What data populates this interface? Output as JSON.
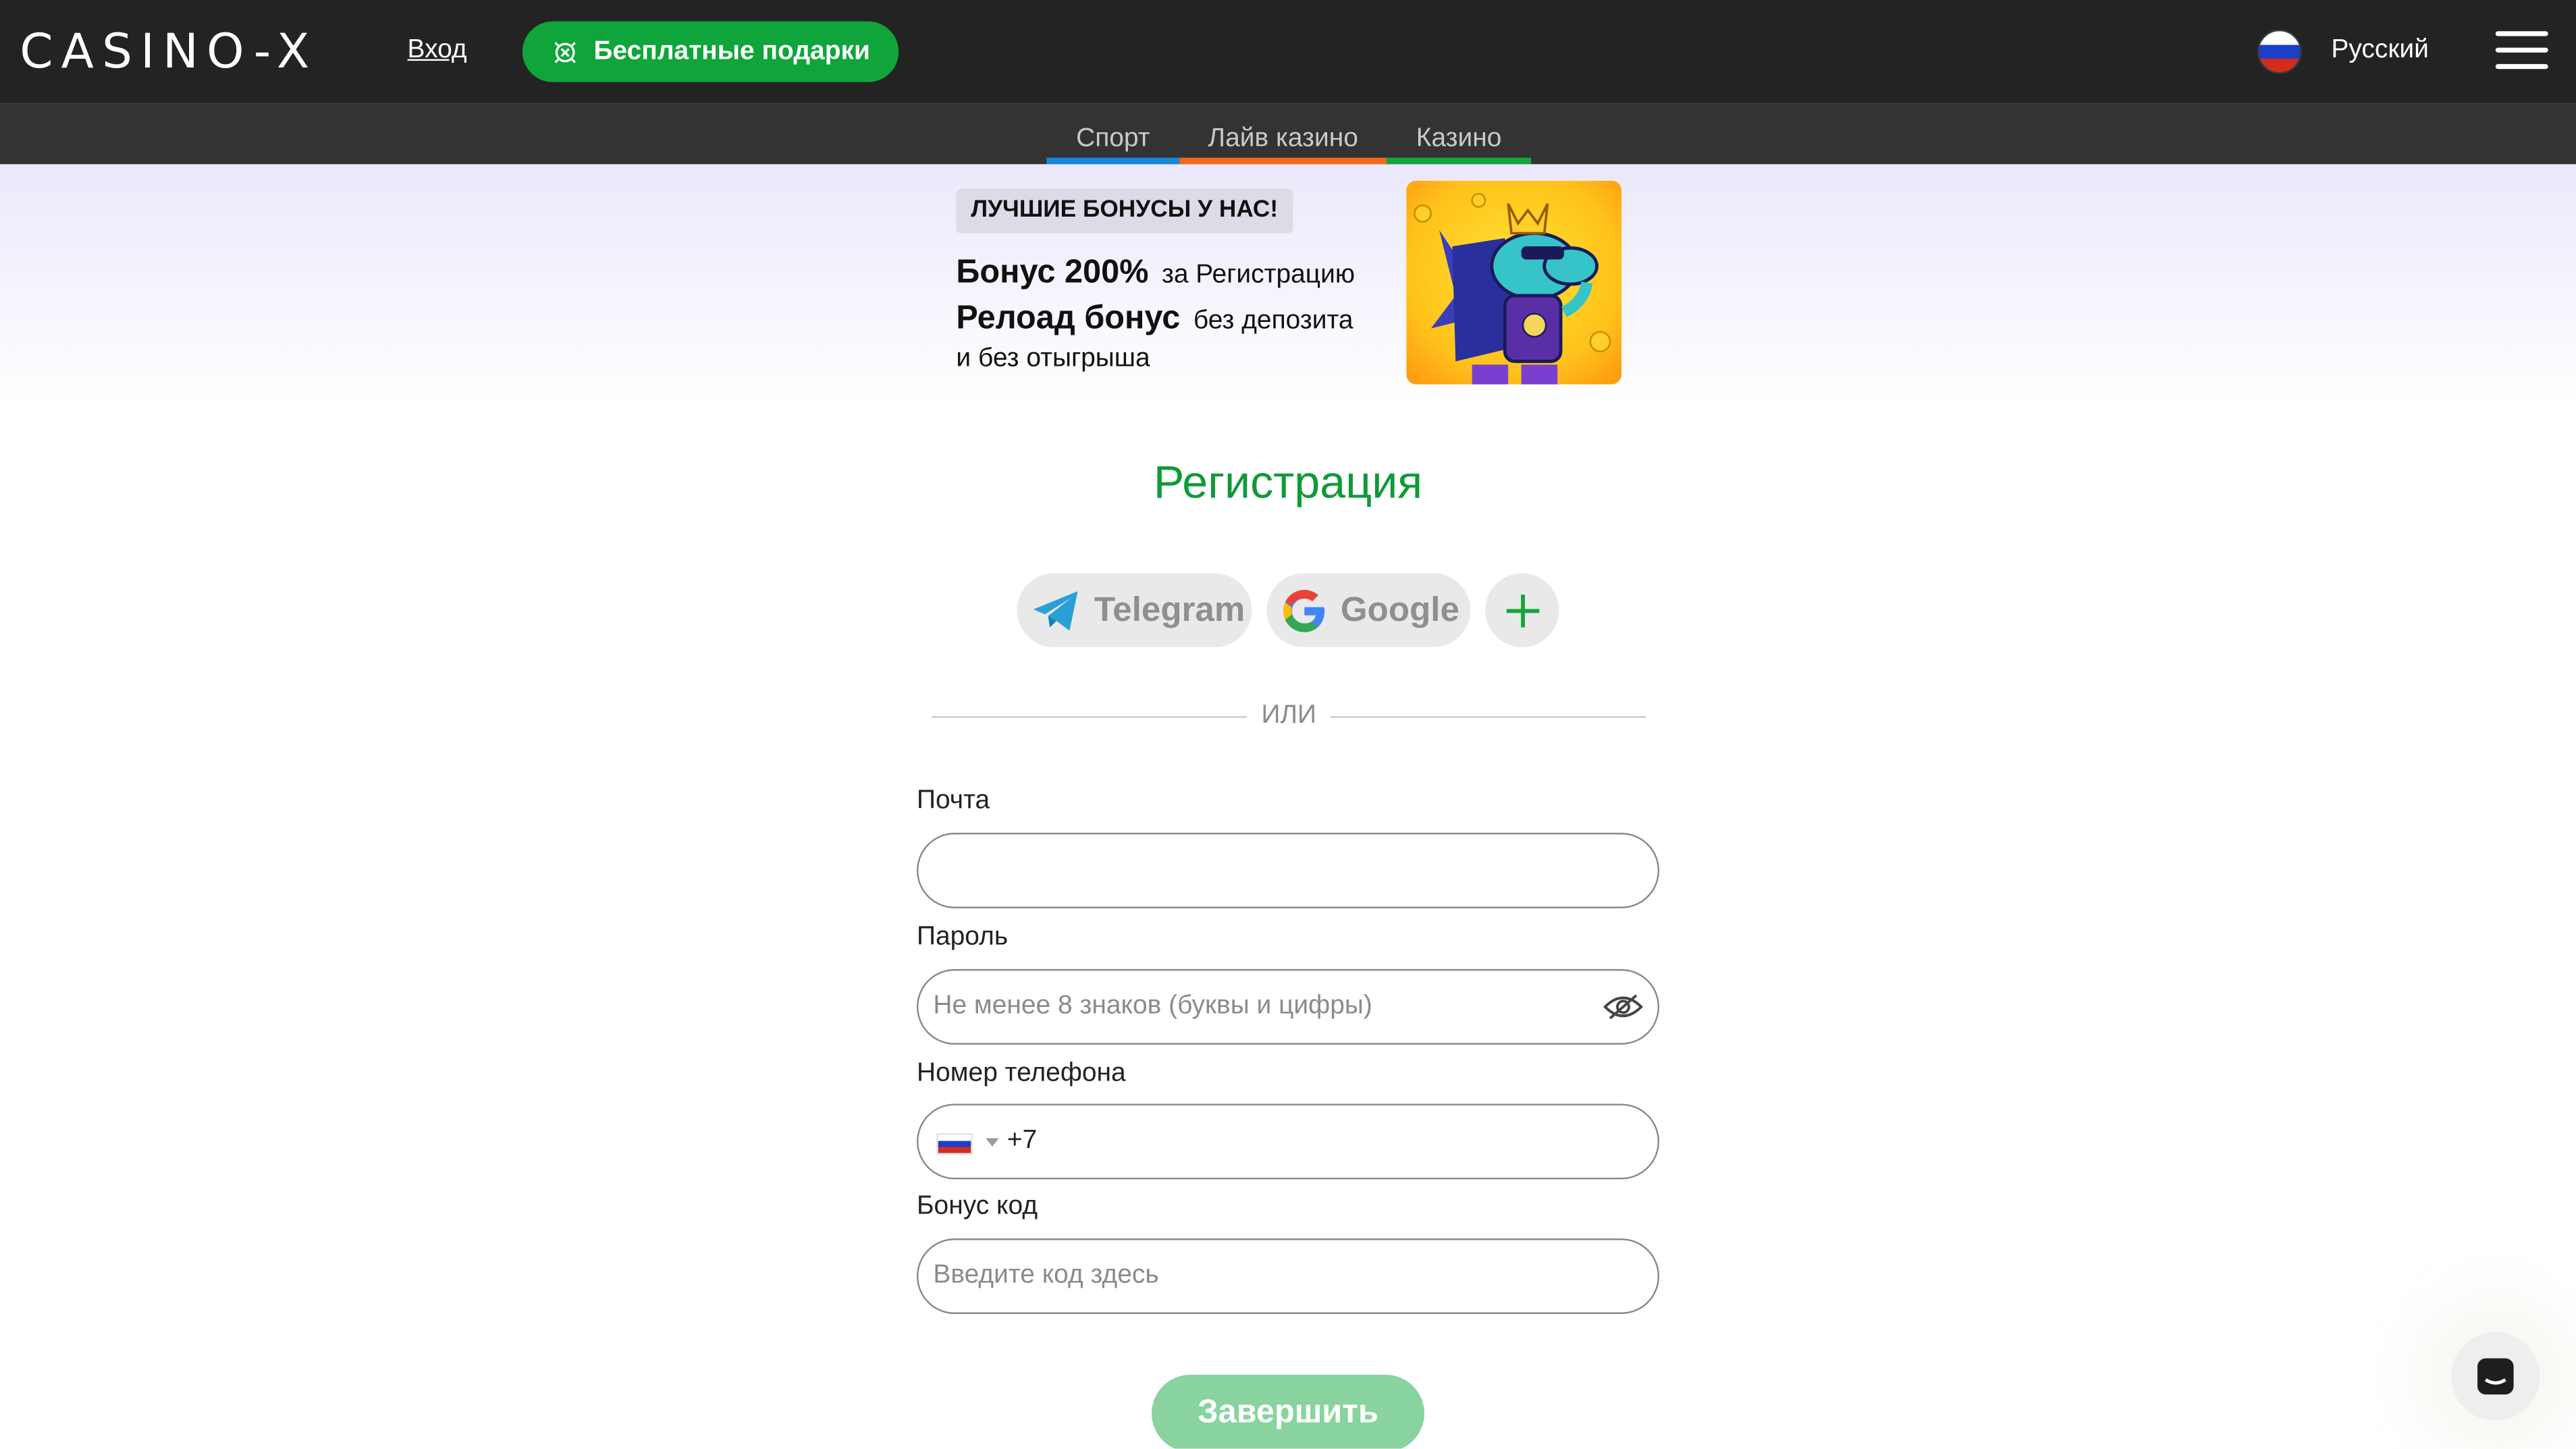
{
  "header": {
    "logo": "CASINO-X",
    "login_label": "Вход",
    "gifts_label": "Бесплатные подарки",
    "language_label": "Русский"
  },
  "categories": [
    {
      "label": "Спорт",
      "color": "#1987d8"
    },
    {
      "label": "Лайв казино",
      "color": "#f06a1d"
    },
    {
      "label": "Казино",
      "color": "#14a43c"
    }
  ],
  "banner": {
    "badge": "ЛУЧШИЕ БОНУСЫ У НАС!",
    "line1_big": "Бонус 200%",
    "line1_small": "за Регистрацию",
    "line2_big": "Релоад бонус",
    "line2_small": "без депозита",
    "line3": "и без отыгрыша"
  },
  "registration": {
    "title": "Регистрация",
    "social": {
      "telegram": "Telegram",
      "google": "Google"
    },
    "or_text": "ИЛИ",
    "email": {
      "label": "Почта",
      "value": "",
      "placeholder": ""
    },
    "password": {
      "label": "Пароль",
      "value": "",
      "placeholder": "Не менее 8 знаков (буквы и цифры)"
    },
    "phone": {
      "label": "Номер телефона",
      "value": "+7",
      "placeholder": ""
    },
    "bonus": {
      "label": "Бонус код",
      "value": "",
      "placeholder": "Введите код здесь"
    },
    "submit_label": "Завершить"
  },
  "colors": {
    "brand_green": "#0fa53a",
    "title_green": "#0f9a38",
    "header_bg": "#232323"
  }
}
